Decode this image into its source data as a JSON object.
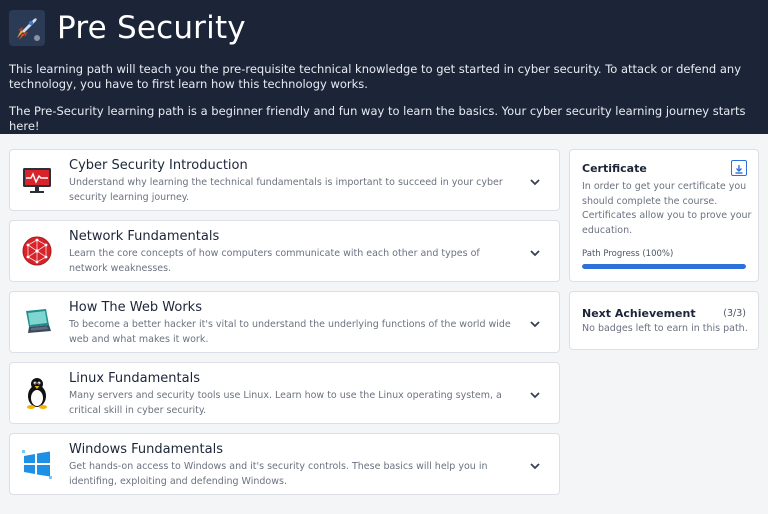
{
  "hero": {
    "title": "Pre Security",
    "description_1": "This learning path will teach you the pre-requisite technical knowledge to get started in cyber security. To attack or defend any technology, you have to first learn how this technology works.",
    "description_2": "The Pre-Security learning path is a beginner friendly and fun way to learn the basics. Your cyber security learning journey starts here!",
    "logo_icon": "rocket-icon"
  },
  "modules": [
    {
      "title": "Cyber Security Introduction",
      "description": "Understand why learning the technical fundamentals is important to succeed in your cyber security learning journey.",
      "icon": "monitor-heartbeat-icon"
    },
    {
      "title": "Network Fundamentals",
      "description": "Learn the core concepts of how computers communicate with each other and types of network weaknesses.",
      "icon": "network-globe-icon"
    },
    {
      "title": "How The Web Works",
      "description": "To become a better hacker it's vital to understand the underlying functions of the world wide web and what makes it work.",
      "icon": "laptop-icon"
    },
    {
      "title": "Linux Fundamentals",
      "description": "Many servers and security tools use Linux. Learn how to use the Linux operating system, a critical skill in cyber security.",
      "icon": "linux-penguin-icon"
    },
    {
      "title": "Windows Fundamentals",
      "description": "Get hands-on access to Windows and it's security controls. These basics will help you in identifing, exploiting and defending Windows.",
      "icon": "windows-logo-icon"
    }
  ],
  "certificate": {
    "title": "Certificate",
    "description": "In order to get your certificate you should complete the course. Certificates allow you to prove your education.",
    "progress_label": "Path Progress (100%)",
    "progress": 1.0,
    "download_icon": "download-icon"
  },
  "achievement": {
    "title": "Next Achievement",
    "count": "(3/3)",
    "description": "No badges left to earn in this path."
  },
  "colors": {
    "hero_bg": "#1c2538",
    "accent": "#2e6fd8",
    "page_bg": "#f4f5f7"
  }
}
